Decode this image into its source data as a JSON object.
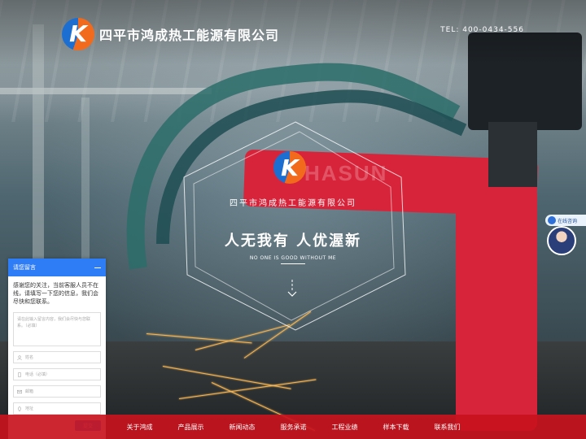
{
  "header": {
    "logo_letter": "K",
    "company_name": "四平市鸿成热工能源有限公司",
    "phone": "TEL: 400-0434-556"
  },
  "hero": {
    "logo_letter": "K",
    "brand_text": "HASUN",
    "company_name": "四平市鸿成热工能源有限公司",
    "slogan": "人无我有  人优渥新",
    "english": "NO ONE IS GOOD WITHOUT ME"
  },
  "consult": {
    "label": "在线咨询"
  },
  "message_panel": {
    "title": "请您留言",
    "intro": "感谢您的关注，当前客服人员不在线，请填写一下您的信息，我们会尽快和您联系。",
    "textarea_placeholder": "请在此输入留言内容，我们会尽快与您联系。（必填）",
    "fields": [
      {
        "icon": "user-icon",
        "placeholder": "姓名"
      },
      {
        "icon": "phone-icon",
        "placeholder": "电话（必填）"
      },
      {
        "icon": "mail-icon",
        "placeholder": "邮箱"
      },
      {
        "icon": "location-icon",
        "placeholder": "地址"
      }
    ],
    "submit": "提交"
  },
  "nav": {
    "items": [
      "关于鸿成",
      "产品展示",
      "新闻动态",
      "服务承诺",
      "工程业绩",
      "样本下载",
      "联系我们"
    ]
  },
  "colors": {
    "nav_red": "#c8141e",
    "panel_blue": "#2e7cf6",
    "logo_orange": "#f26b1d",
    "logo_blue": "#1c6fd1"
  }
}
